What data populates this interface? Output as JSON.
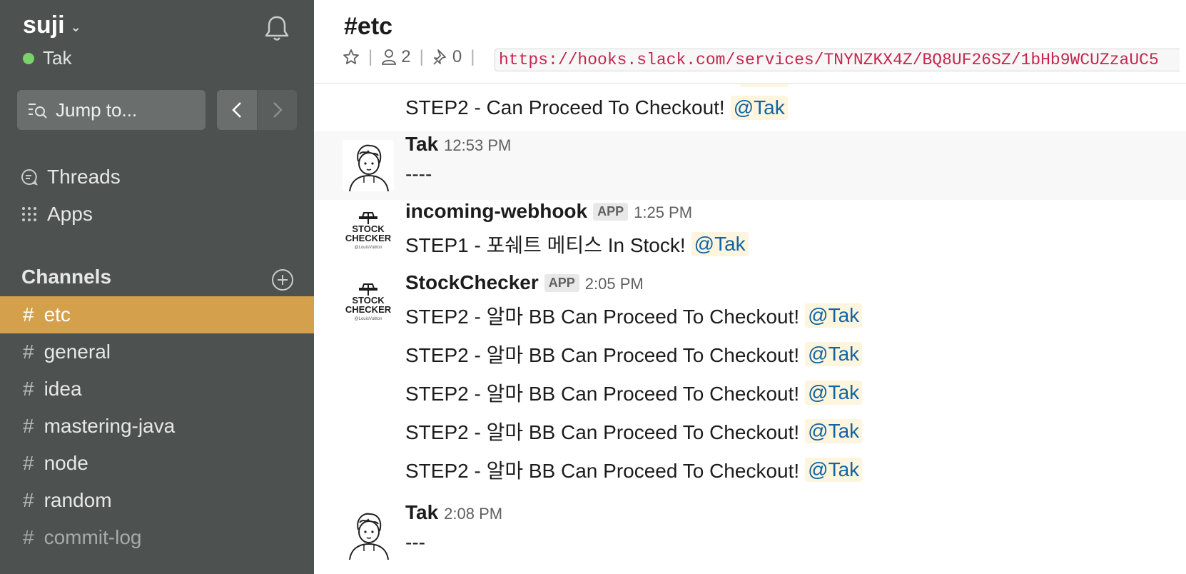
{
  "workspace": {
    "name": "suji",
    "user": "Tak"
  },
  "sidebar": {
    "jump_placeholder": "Jump to...",
    "items": [
      {
        "label": "Threads",
        "icon": "threads-icon"
      },
      {
        "label": "Apps",
        "icon": "apps-icon"
      }
    ],
    "channels_header": "Channels",
    "channels": [
      {
        "name": "etc",
        "active": true
      },
      {
        "name": "general"
      },
      {
        "name": "idea"
      },
      {
        "name": "mastering-java"
      },
      {
        "name": "node"
      },
      {
        "name": "random"
      },
      {
        "name": "commit-log",
        "muted": true
      }
    ]
  },
  "header": {
    "channel_title": "#etc",
    "member_count": "2",
    "pinned_count": "0",
    "topic": "https://hooks.slack.com/services/TNYNZKX4Z/BQ8UF26SZ/1bHb9WCUZzaUC5"
  },
  "messages": {
    "top_line": {
      "text": "STEP2 - Can Proceed To Checkout!",
      "mention": "@Tak"
    },
    "m1": {
      "sender": "Tak",
      "time": "12:53 PM",
      "text": "----"
    },
    "m2": {
      "sender": "incoming-webhook",
      "badge": "APP",
      "time": "1:25 PM",
      "text": "STEP1 - 포쉐트 메티스 In Stock!",
      "mention": "@Tak"
    },
    "m3": {
      "sender": "StockChecker",
      "badge": "APP",
      "time": "2:05 PM",
      "lines": [
        {
          "text": "STEP2 - 알마 BB Can Proceed To Checkout!",
          "mention": "@Tak"
        },
        {
          "text": "STEP2 - 알마 BB Can Proceed To Checkout!",
          "mention": "@Tak"
        },
        {
          "text": "STEP2 - 알마 BB Can Proceed To Checkout!",
          "mention": "@Tak"
        },
        {
          "text": "STEP2 - 알마 BB Can Proceed To Checkout!",
          "mention": "@Tak"
        },
        {
          "text": "STEP2 - 알마 BB Can Proceed To Checkout!",
          "mention": "@Tak"
        }
      ]
    },
    "m4": {
      "sender": "Tak",
      "time": "2:08 PM",
      "text": "---"
    }
  },
  "bot_logo": {
    "line1": "STOCK",
    "line2": "CHECKER",
    "line3": "@LouisVuitton"
  },
  "colors": {
    "sidebar_bg": "#4d5250",
    "active_channel": "#d4a04c",
    "mention_bg": "#fdf5dd",
    "mention_fg": "#1264a3",
    "presence": "#7bd16b"
  }
}
